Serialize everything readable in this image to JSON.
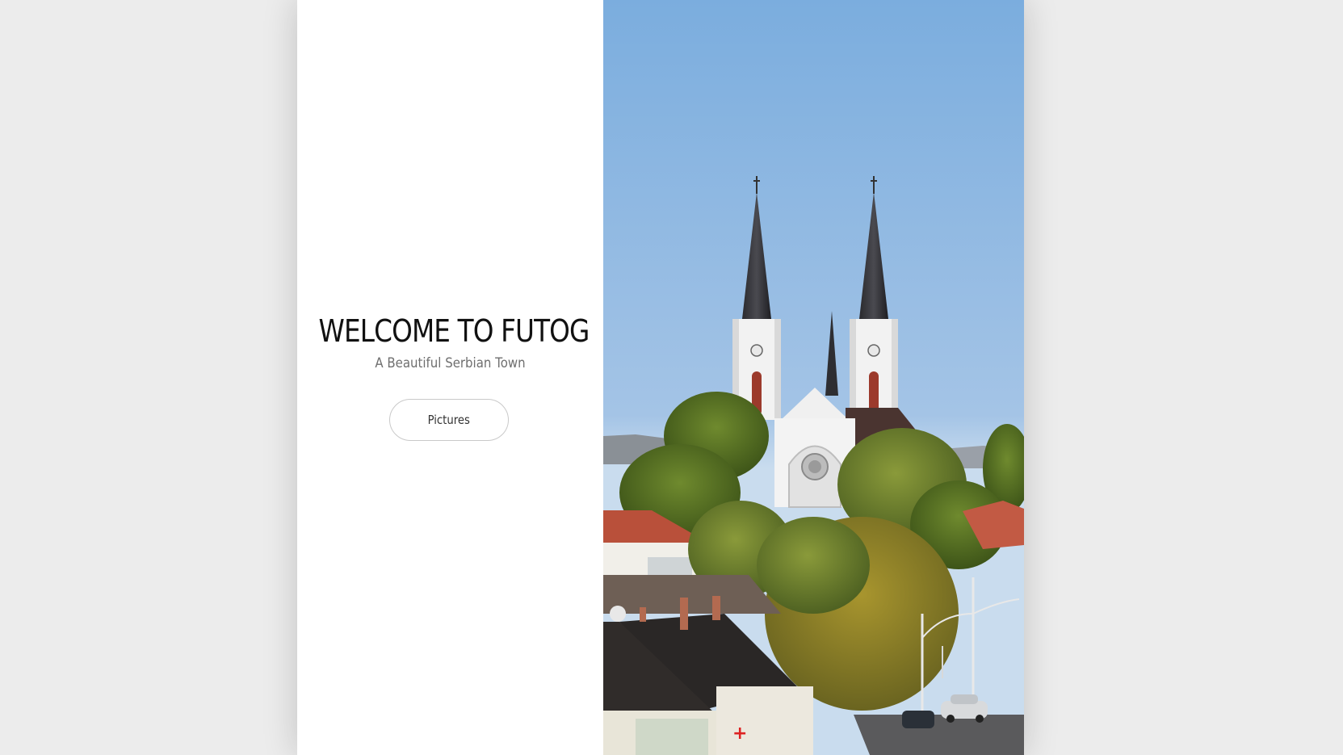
{
  "hero": {
    "title": "WELCOME TO FUTOG",
    "subtitle": "A Beautiful Serbian Town",
    "button_label": "Pictures"
  },
  "colors": {
    "page_background": "#ececec",
    "panel_background": "#ffffff",
    "title_color": "#111111",
    "subtitle_color": "#6f6f6f",
    "sky_top": "#7badde",
    "sky_bottom": "#c9dcee"
  },
  "image": {
    "subject": "church-with-twin-spires-photo"
  }
}
